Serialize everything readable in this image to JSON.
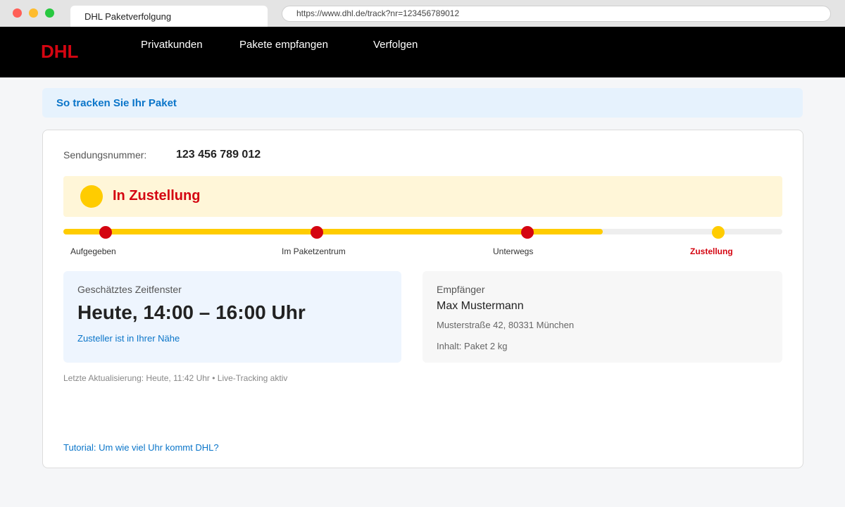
{
  "browser": {
    "tab_title": "DHL Paketverfolgung",
    "url": "https://www.dhl.de/track?nr=123456789012"
  },
  "nav": {
    "logo": "DHL",
    "items": [
      "Privatkunden",
      "Pakete empfangen",
      "Verfolgen"
    ],
    "logo_color": "#d40511",
    "background": "#000000"
  },
  "banner": {
    "link": "So tracken Sie Ihr Paket"
  },
  "shipment": {
    "number_label": "Sendungsnummer:",
    "number": "123 456 789 012",
    "status": "In Zustellung",
    "status_color": "#d40511",
    "accent_yellow": "#ffcc00"
  },
  "progress": {
    "fraction": 0.75,
    "steps": [
      {
        "label": "Aufgegeben",
        "state": "done"
      },
      {
        "label": "Im Paketzentrum",
        "state": "done"
      },
      {
        "label": "Unterwegs",
        "state": "done"
      },
      {
        "label": "Zustellung",
        "state": "current"
      }
    ]
  },
  "eta": {
    "label": "Geschätztes Zeitfenster",
    "value": "Heute, 14:00 – 16:00 Uhr",
    "link": "Zusteller ist in Ihrer Nähe"
  },
  "recipient": {
    "label": "Empfänger",
    "name": "Max Mustermann",
    "address": "Musterstraße 42, 80331 München",
    "content": "Inhalt: Paket 2 kg"
  },
  "footer": {
    "updated": "Letzte Aktualisierung: Heute, 11:42 Uhr • Live-Tracking aktiv",
    "tutorial_link": "Tutorial: Um wie viel Uhr kommt DHL?"
  }
}
